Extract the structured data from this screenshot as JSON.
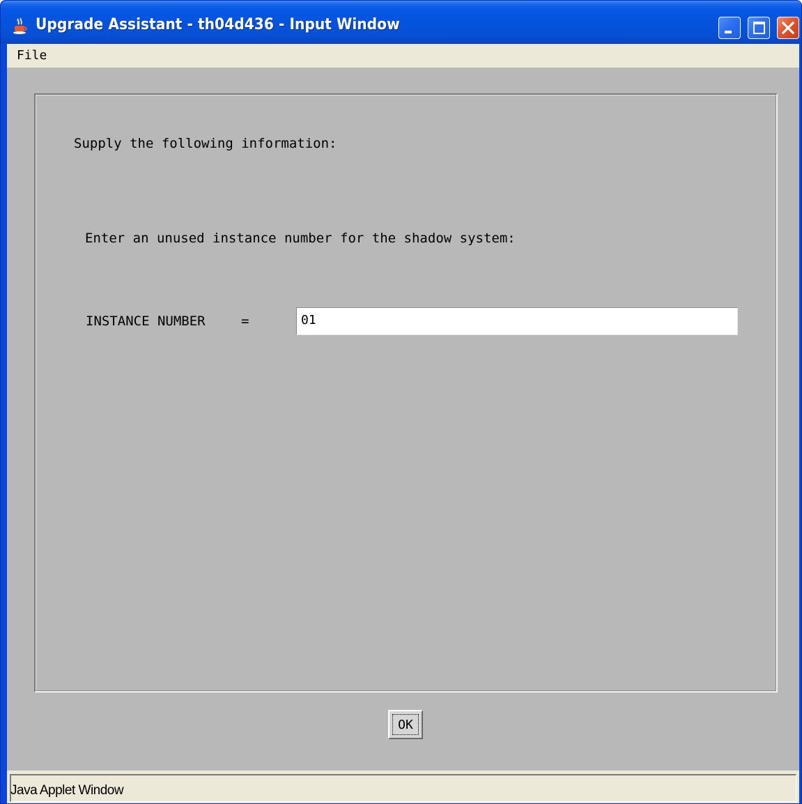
{
  "window": {
    "title": "Upgrade Assistant - th04d436 - Input Window",
    "icon": "java-coffee-cup-icon",
    "controls": [
      "minimize",
      "maximize",
      "close"
    ]
  },
  "menubar": {
    "items": [
      "File"
    ]
  },
  "form": {
    "intro": "Supply the following information:",
    "prompt": "Enter an unused instance number for the shadow system:",
    "field_label": "INSTANCE NUMBER",
    "field_separator": "=",
    "instance_value": "01"
  },
  "buttons": {
    "ok_label": "OK"
  },
  "status_bar": {
    "text": "Java Applet Window"
  },
  "colors": {
    "titlebar": "#0553dd",
    "client_background": "#b8b8b8",
    "menubar_background": "#ece9d8",
    "close_button": "#e2542e"
  }
}
